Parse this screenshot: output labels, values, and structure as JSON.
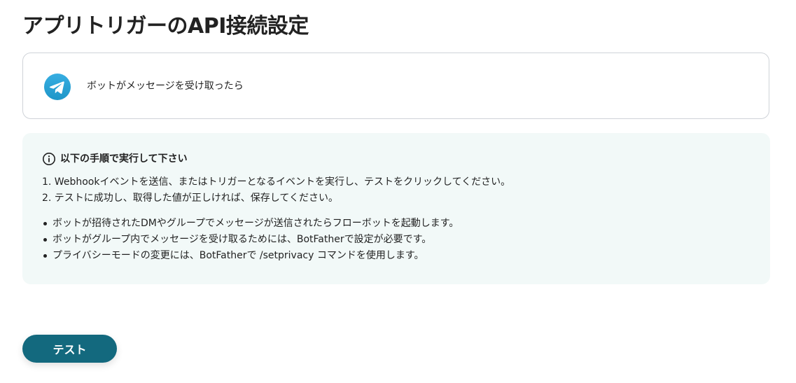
{
  "page": {
    "title": "アプリトリガーのAPI接続設定"
  },
  "trigger_card": {
    "icon": "telegram-icon",
    "label": "ボットがメッセージを受け取ったら"
  },
  "info_box": {
    "icon": "info-icon",
    "heading": "以下の手順で実行して下さい",
    "steps": [
      "1. Webhookイベントを送信、またはトリガーとなるイベントを実行し、テストをクリックしてください。",
      "2. テストに成功し、取得した値が正しければ、保存してください。"
    ],
    "notes": [
      "ボットが招待されたDMやグループでメッセージが送信されたらフローボットを起動します。",
      "ボットがグループ内でメッセージを受け取るためには、BotFatherで設定が必要です。",
      "プライバシーモードの変更には、BotFatherで /setprivacy コマンドを使用します。"
    ]
  },
  "actions": {
    "test_label": "テスト"
  },
  "colors": {
    "primary": "#13697e",
    "info_background": "#f2f9f8",
    "card_border": "#cfd3d8",
    "telegram_blue": "#2aa3df",
    "text": "#222222"
  }
}
